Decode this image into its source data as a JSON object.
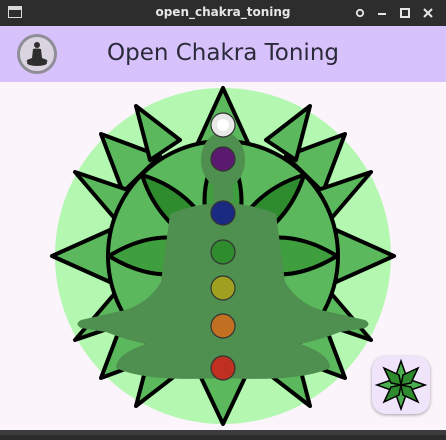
{
  "window": {
    "title": "open_chakra_toning",
    "controls": [
      "pin-icon",
      "minimize-icon",
      "maximize-icon",
      "close-icon"
    ]
  },
  "appbar": {
    "title": "Open Chakra Toning",
    "logo_icon": "meditation-figure-icon"
  },
  "artwork": {
    "background_circle_color": "#b4f7b0",
    "petal_color": "#5cb85c",
    "petal_dark_color": "#2e8b2e",
    "figure_color": "#4f8f4f",
    "chakras": [
      {
        "name": "crown",
        "color": "#e8e8e8"
      },
      {
        "name": "third-eye",
        "color": "#5a1a6e"
      },
      {
        "name": "throat",
        "color": "#1a2a80"
      },
      {
        "name": "heart",
        "color": "#2e8b2e"
      },
      {
        "name": "solar-plexus",
        "color": "#a0a020"
      },
      {
        "name": "sacral",
        "color": "#c07020"
      },
      {
        "name": "root",
        "color": "#c03020"
      }
    ]
  },
  "fab": {
    "icon": "lotus-flower-icon"
  }
}
